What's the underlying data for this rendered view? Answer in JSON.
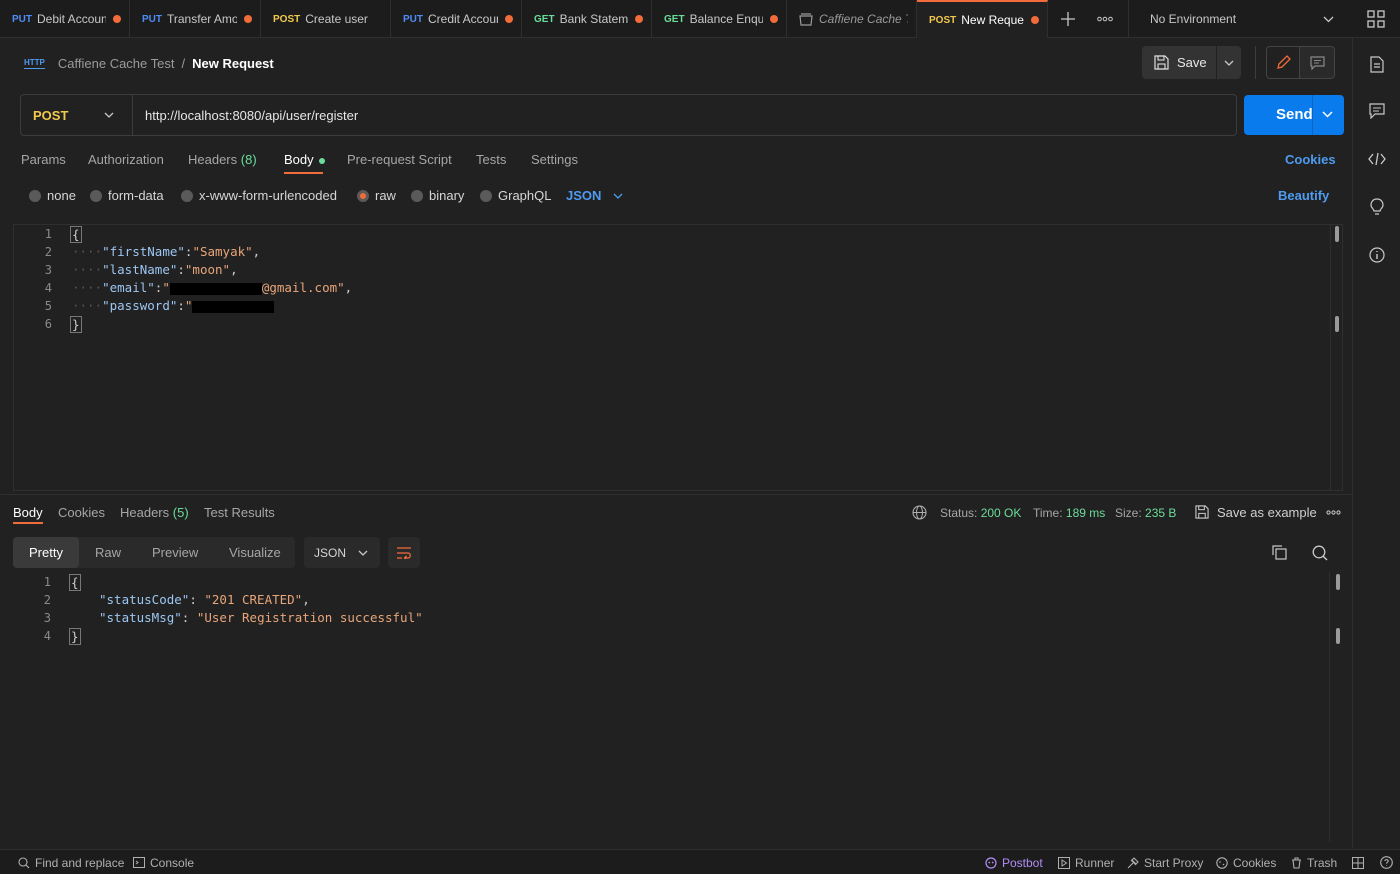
{
  "tabs": [
    {
      "method": "PUT",
      "title": "Debit Account"
    },
    {
      "method": "PUT",
      "title": "Transfer Amou"
    },
    {
      "method": "POST",
      "title": "Create user"
    },
    {
      "method": "PUT",
      "title": "Credit Accoun"
    },
    {
      "method": "GET",
      "title": "Bank Statemen"
    },
    {
      "method": "GET",
      "title": "Balance Enquir"
    },
    {
      "method": "",
      "title": "Caffiene Cache T"
    },
    {
      "method": "POST",
      "title": "New Request"
    }
  ],
  "environment": "No Environment",
  "breadcrumb": {
    "collection": "Caffiene Cache Test",
    "separator": "/",
    "request": "New Request",
    "badge": "HTTP"
  },
  "toolbar": {
    "save_label": "Save"
  },
  "request": {
    "method": "POST",
    "url": "http://localhost:8080/api/user/register",
    "send_label": "Send"
  },
  "request_tabs": {
    "params": "Params",
    "authorization": "Authorization",
    "headers": "Headers",
    "headers_count": "(8)",
    "body": "Body",
    "prerequest": "Pre-request Script",
    "tests": "Tests",
    "settings": "Settings",
    "cookies": "Cookies"
  },
  "body_types": {
    "none": "none",
    "form_data": "form-data",
    "urlencoded": "x-www-form-urlencoded",
    "raw": "raw",
    "binary": "binary",
    "graphql": "GraphQL",
    "format": "JSON",
    "beautify": "Beautify"
  },
  "request_body": {
    "line_numbers": [
      "1",
      "2",
      "3",
      "4",
      "5",
      "6"
    ],
    "open": "{",
    "close": "}",
    "first_key": "\"firstName\"",
    "first_val": "\"Samyak\"",
    "last_key": "\"lastName\"",
    "last_val": "\"moon\"",
    "email_key": "\"email\"",
    "email_val_start": "\"",
    "email_val_end": "@gmail.com\"",
    "password_key": "\"password\"",
    "password_val_start": "\""
  },
  "response_tabs": {
    "body": "Body",
    "cookies": "Cookies",
    "headers": "Headers",
    "headers_count": "(5)",
    "test_results": "Test Results"
  },
  "response_meta": {
    "status_label": "Status:",
    "status_value": "200 OK",
    "time_label": "Time:",
    "time_value": "189 ms",
    "size_label": "Size:",
    "size_value": "235 B",
    "save_example": "Save as example"
  },
  "response_view": {
    "pretty": "Pretty",
    "raw": "Raw",
    "preview": "Preview",
    "visualize": "Visualize",
    "format": "JSON"
  },
  "response_body": {
    "line_numbers": [
      "1",
      "2",
      "3",
      "4"
    ],
    "open": "{",
    "close": "}",
    "code_key": "\"statusCode\"",
    "code_val": "\"201 CREATED\"",
    "msg_key": "\"statusMsg\"",
    "msg_val": "\"User Registration successful\""
  },
  "statusbar": {
    "find_replace": "Find and replace",
    "console": "Console",
    "postbot": "Postbot",
    "runner": "Runner",
    "start_proxy": "Start Proxy",
    "cookies": "Cookies",
    "trash": "Trash"
  },
  "colors": {
    "accent": "#f26b3a",
    "send": "#097bed",
    "post": "#f2c94c",
    "put": "#4e8df6",
    "get": "#6bdd9a",
    "link": "#4e9bf0"
  }
}
